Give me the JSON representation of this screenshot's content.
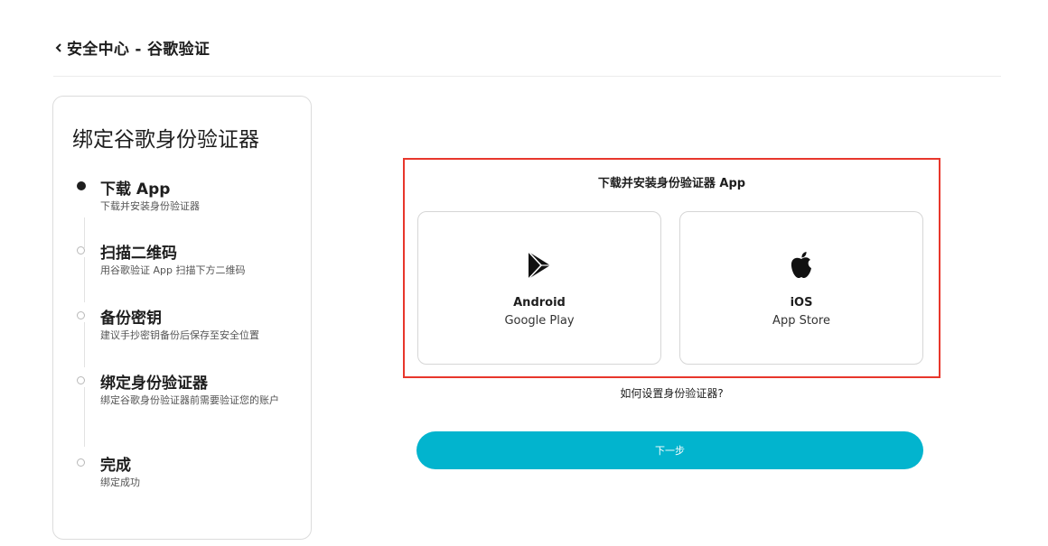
{
  "header": {
    "title": "安全中心 - 谷歌验证",
    "back_icon": "chevron-left-icon"
  },
  "steps_panel": {
    "title": "绑定谷歌身份验证器",
    "steps": [
      {
        "name": "下载 App",
        "desc": "下载并安装身份验证器",
        "state": "active"
      },
      {
        "name": "扫描二维码",
        "desc": "用谷歌验证 App 扫描下方二维码",
        "state": "pending"
      },
      {
        "name": "备份密钥",
        "desc": "建议手抄密钥备份后保存至安全位置",
        "state": "pending"
      },
      {
        "name": "绑定身份验证器",
        "desc": "绑定谷歌身份验证器前需要验证您的账户",
        "state": "pending"
      },
      {
        "name": "完成",
        "desc": "绑定成功",
        "state": "pending"
      }
    ]
  },
  "download": {
    "title": "下载并安装身份验证器 App",
    "android": {
      "name": "Android",
      "store": "Google Play",
      "icon": "google-play-icon"
    },
    "ios": {
      "name": "iOS",
      "store": "App Store",
      "icon": "apple-icon"
    },
    "highlight_color": "#e8372c"
  },
  "help_link": "如何设置身份验证器?",
  "next_button": {
    "label": "下一步",
    "color": "#02b4ce"
  }
}
